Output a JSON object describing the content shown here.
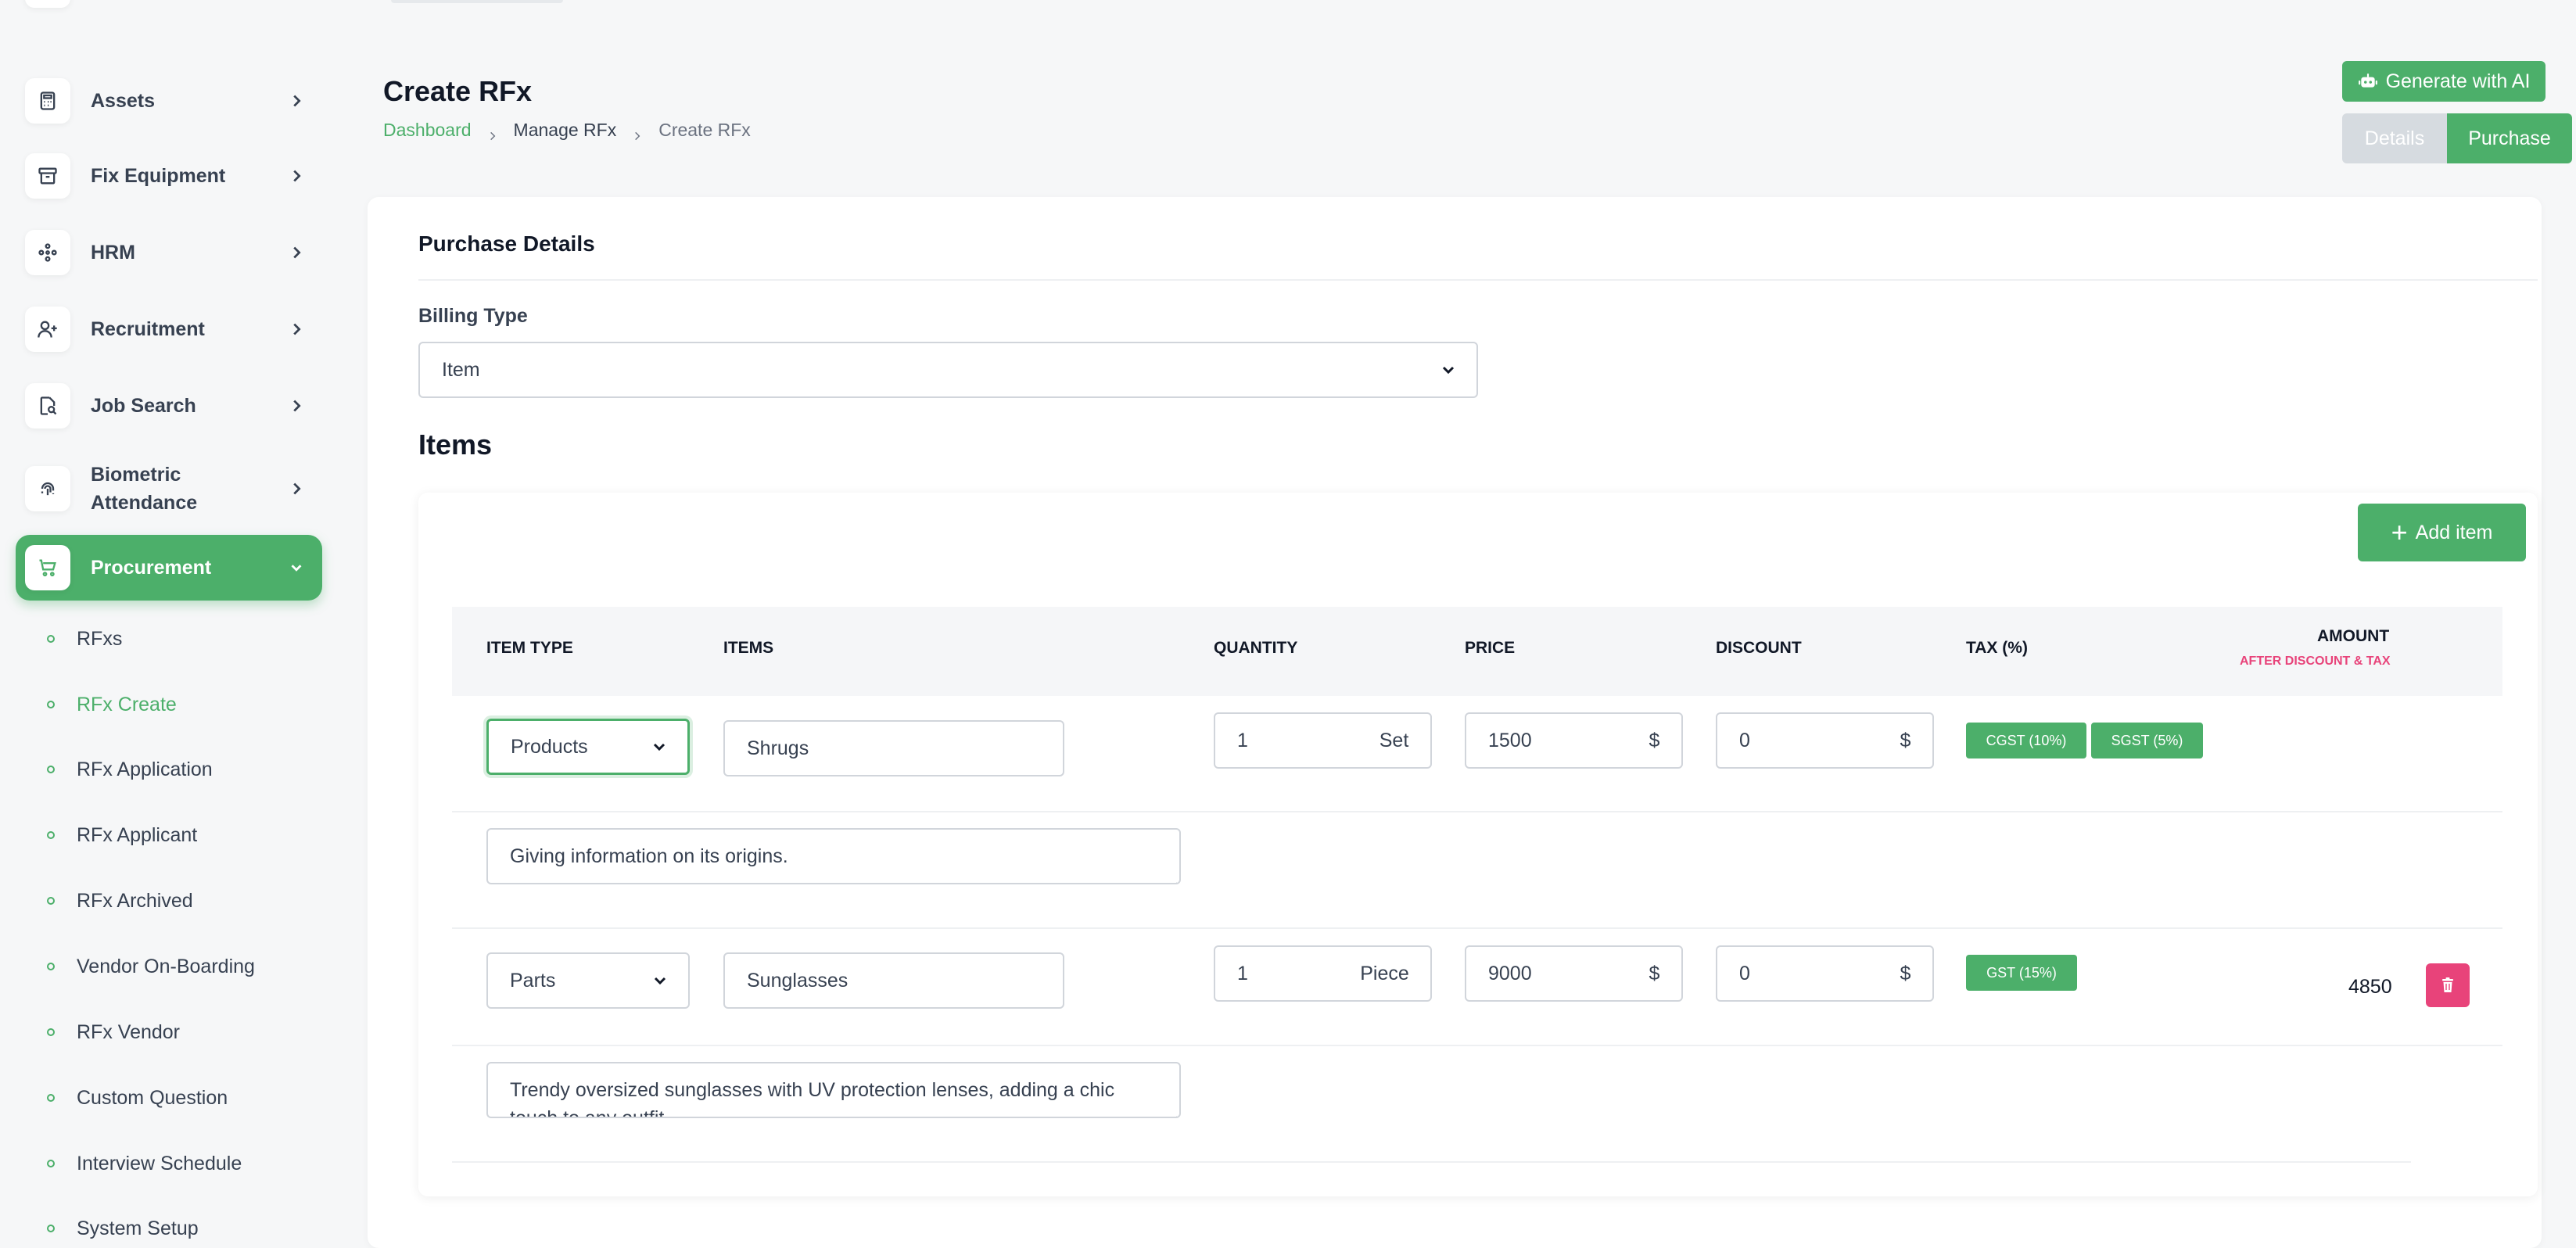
{
  "sidebar": {
    "items": [
      {
        "label": "Assets",
        "icon": "calculator-icon"
      },
      {
        "label": "Fix Equipment",
        "icon": "archive-icon"
      },
      {
        "label": "HRM",
        "icon": "users-network-icon"
      },
      {
        "label": "Recruitment",
        "icon": "user-plus-icon"
      },
      {
        "label": "Job Search",
        "icon": "document-search-icon"
      },
      {
        "label": "Biometric Attendance",
        "icon": "fingerprint-icon"
      },
      {
        "label": "Procurement",
        "icon": "cart-icon",
        "active": true
      }
    ],
    "subitems": [
      {
        "label": "RFxs"
      },
      {
        "label": "RFx Create",
        "current": true
      },
      {
        "label": "RFx Application"
      },
      {
        "label": "RFx Applicant"
      },
      {
        "label": "RFx Archived"
      },
      {
        "label": "Vendor On-Boarding"
      },
      {
        "label": "RFx Vendor"
      },
      {
        "label": "Custom Question"
      },
      {
        "label": "Interview Schedule"
      },
      {
        "label": "System Setup"
      }
    ]
  },
  "header": {
    "title": "Create RFx",
    "breadcrumb": [
      "Dashboard",
      "Manage RFx",
      "Create RFx"
    ],
    "generate_ai_label": "Generate with AI",
    "tabs": [
      "Details",
      "Purchase"
    ],
    "active_tab": "Purchase"
  },
  "purchase": {
    "section_title": "Purchase Details",
    "billing_label": "Billing Type",
    "billing_value": "Item",
    "items_title": "Items",
    "add_item_label": "Add item"
  },
  "table": {
    "headers": {
      "item_type": "ITEM TYPE",
      "items": "ITEMS",
      "quantity": "QUANTITY",
      "price": "PRICE",
      "discount": "DISCOUNT",
      "tax": "TAX (%)",
      "amount": "AMOUNT",
      "amount_sub": "AFTER DISCOUNT & TAX"
    },
    "rows": [
      {
        "item_type": "Products",
        "item": "Shrugs",
        "quantity": "1",
        "unit": "Set",
        "price": "1500",
        "price_currency": "$",
        "discount": "0",
        "discount_currency": "$",
        "taxes": [
          "CGST (10%)",
          "SGST (5%)"
        ],
        "amount": "",
        "description": "Giving information on its origins."
      },
      {
        "item_type": "Parts",
        "item": "Sunglasses",
        "quantity": "1",
        "unit": "Piece",
        "price": "9000",
        "price_currency": "$",
        "discount": "0",
        "discount_currency": "$",
        "taxes": [
          "GST (15%)"
        ],
        "amount": "4850",
        "description": "Trendy oversized sunglasses with UV protection lenses, adding a chic touch to any outfit."
      }
    ]
  },
  "colors": {
    "accent": "#4caf6a",
    "danger": "#e8437a",
    "muted_tab": "#d6dbe0"
  }
}
